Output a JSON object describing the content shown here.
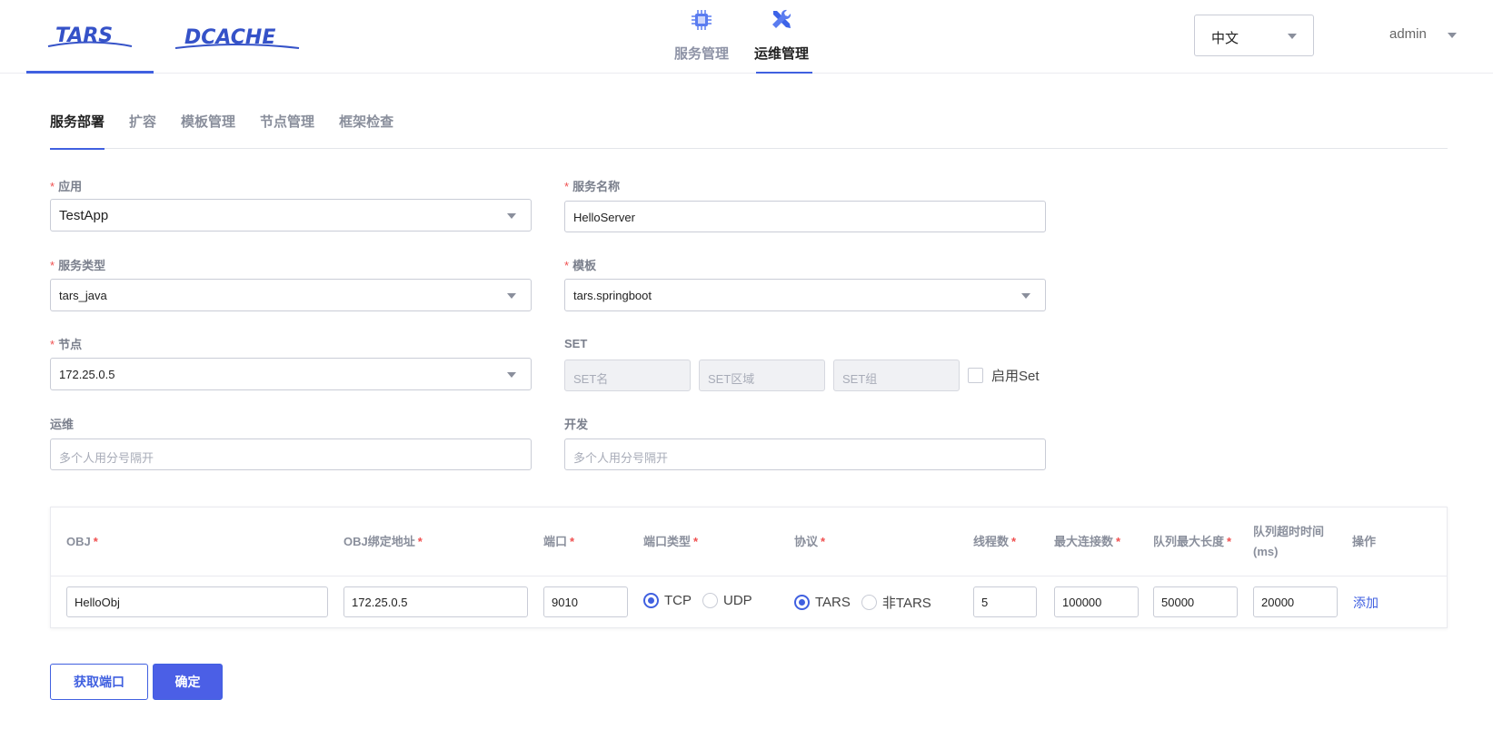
{
  "header": {
    "logos": {
      "tars": "TARS",
      "dcache": "DCACHE"
    },
    "nav": [
      {
        "label": "服务管理",
        "icon": "chip-icon",
        "active": false
      },
      {
        "label": "运维管理",
        "icon": "wrench-screwdriver-icon",
        "active": true
      }
    ],
    "language": "中文",
    "user": "admin"
  },
  "subtabs": [
    "服务部署",
    "扩容",
    "模板管理",
    "节点管理",
    "框架检查"
  ],
  "form": {
    "app": {
      "label": "应用",
      "value": "TestApp"
    },
    "server_name": {
      "label": "服务名称",
      "value": "HelloServer"
    },
    "server_type": {
      "label": "服务类型",
      "value": "tars_java"
    },
    "template": {
      "label": "模板",
      "value": "tars.springboot"
    },
    "node": {
      "label": "节点",
      "value": "172.25.0.5"
    },
    "set": {
      "label": "SET",
      "name_placeholder": "SET名",
      "area_placeholder": "SET区域",
      "group_placeholder": "SET组",
      "enable_label": "启用Set"
    },
    "ops": {
      "label": "运维",
      "placeholder": "多个人用分号隔开"
    },
    "dev": {
      "label": "开发",
      "placeholder": "多个人用分号隔开"
    }
  },
  "table": {
    "headers": {
      "obj": "OBJ",
      "bind": "OBJ绑定地址",
      "port": "端口",
      "port_type": "端口类型",
      "protocol": "协议",
      "threads": "线程数",
      "max_conn": "最大连接数",
      "queue_len": "队列最大长度",
      "queue_timeout": "队列超时时间(ms)",
      "action": "操作"
    },
    "row": {
      "obj": "HelloObj",
      "bind": "172.25.0.5",
      "port": "9010",
      "port_type_options": [
        "TCP",
        "UDP"
      ],
      "port_type_selected": "TCP",
      "protocol_options": [
        "TARS",
        "非TARS"
      ],
      "protocol_selected": "TARS",
      "threads": "5",
      "max_conn": "100000",
      "queue_len": "50000",
      "queue_timeout": "20000",
      "action": "添加"
    }
  },
  "buttons": {
    "get_port": "获取端口",
    "confirm": "确定"
  },
  "colors": {
    "accent": "#4060e0",
    "required": "#f05050"
  }
}
